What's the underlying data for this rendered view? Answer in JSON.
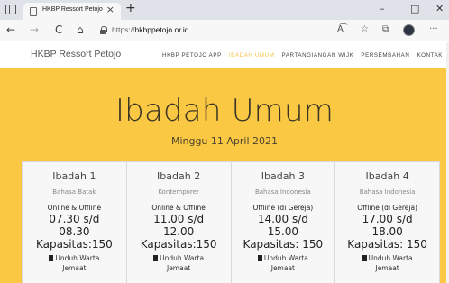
{
  "browser": {
    "tab_title": "HKBP Ressort Petojo",
    "tab_close": "×",
    "new_tab": "+",
    "window_controls": {
      "minimize": "–",
      "maximize": "□",
      "close": "✕"
    },
    "nav": {
      "back": "←",
      "forward": "→",
      "reload": "C",
      "home": "⌂"
    },
    "url_prefix": "https://",
    "url_host": "hkbppetojo.or.id",
    "toolbar_icons": {
      "read_aloud": "A͡",
      "favorites": "☆",
      "collections": "⧉",
      "more": "···"
    }
  },
  "site": {
    "brand": "HKBP Ressort Petojo",
    "menu": [
      {
        "label": "HKBP PETOJO APP",
        "active": false
      },
      {
        "label": "IBADAH UMUM",
        "active": true
      },
      {
        "label": "PARTANGIANGAN WIJK",
        "active": false
      },
      {
        "label": "PERSEMBAHAN",
        "active": false
      },
      {
        "label": "KONTAK",
        "active": false
      }
    ]
  },
  "hero": {
    "title": "Ibadah Umum",
    "date": "Minggu 11 April 2021",
    "background_color": "#fbc844"
  },
  "services": [
    {
      "title": "Ibadah 1",
      "language": "Bahasa Batak",
      "mode": "Online & Offline",
      "start": "07.30 s/d",
      "end": "08.30",
      "capacity": "Kapasitas:150",
      "download": "Unduh Warta Jemaat"
    },
    {
      "title": "Ibadah 2",
      "language": "Kontemporer",
      "mode": "Online & Offline",
      "start": "11.00 s/d",
      "end": "12.00",
      "capacity": "Kapasitas:150",
      "download": "Unduh Warta Jemaat"
    },
    {
      "title": "Ibadah 3",
      "language": "Bahasa Indonesia",
      "mode": "Offline (di Gereja)",
      "start": "14.00 s/d",
      "end": "15.00",
      "capacity": "Kapasitas: 150",
      "download": "Unduh Warta Jemaat"
    },
    {
      "title": "Ibadah 4",
      "language": "Bahasa Indonesia",
      "mode": "Offline (di Gereja)",
      "start": "17.00 s/d",
      "end": "18.00",
      "capacity": "Kapasitas: 150",
      "download": "Unduh Warta Jemaat"
    }
  ]
}
